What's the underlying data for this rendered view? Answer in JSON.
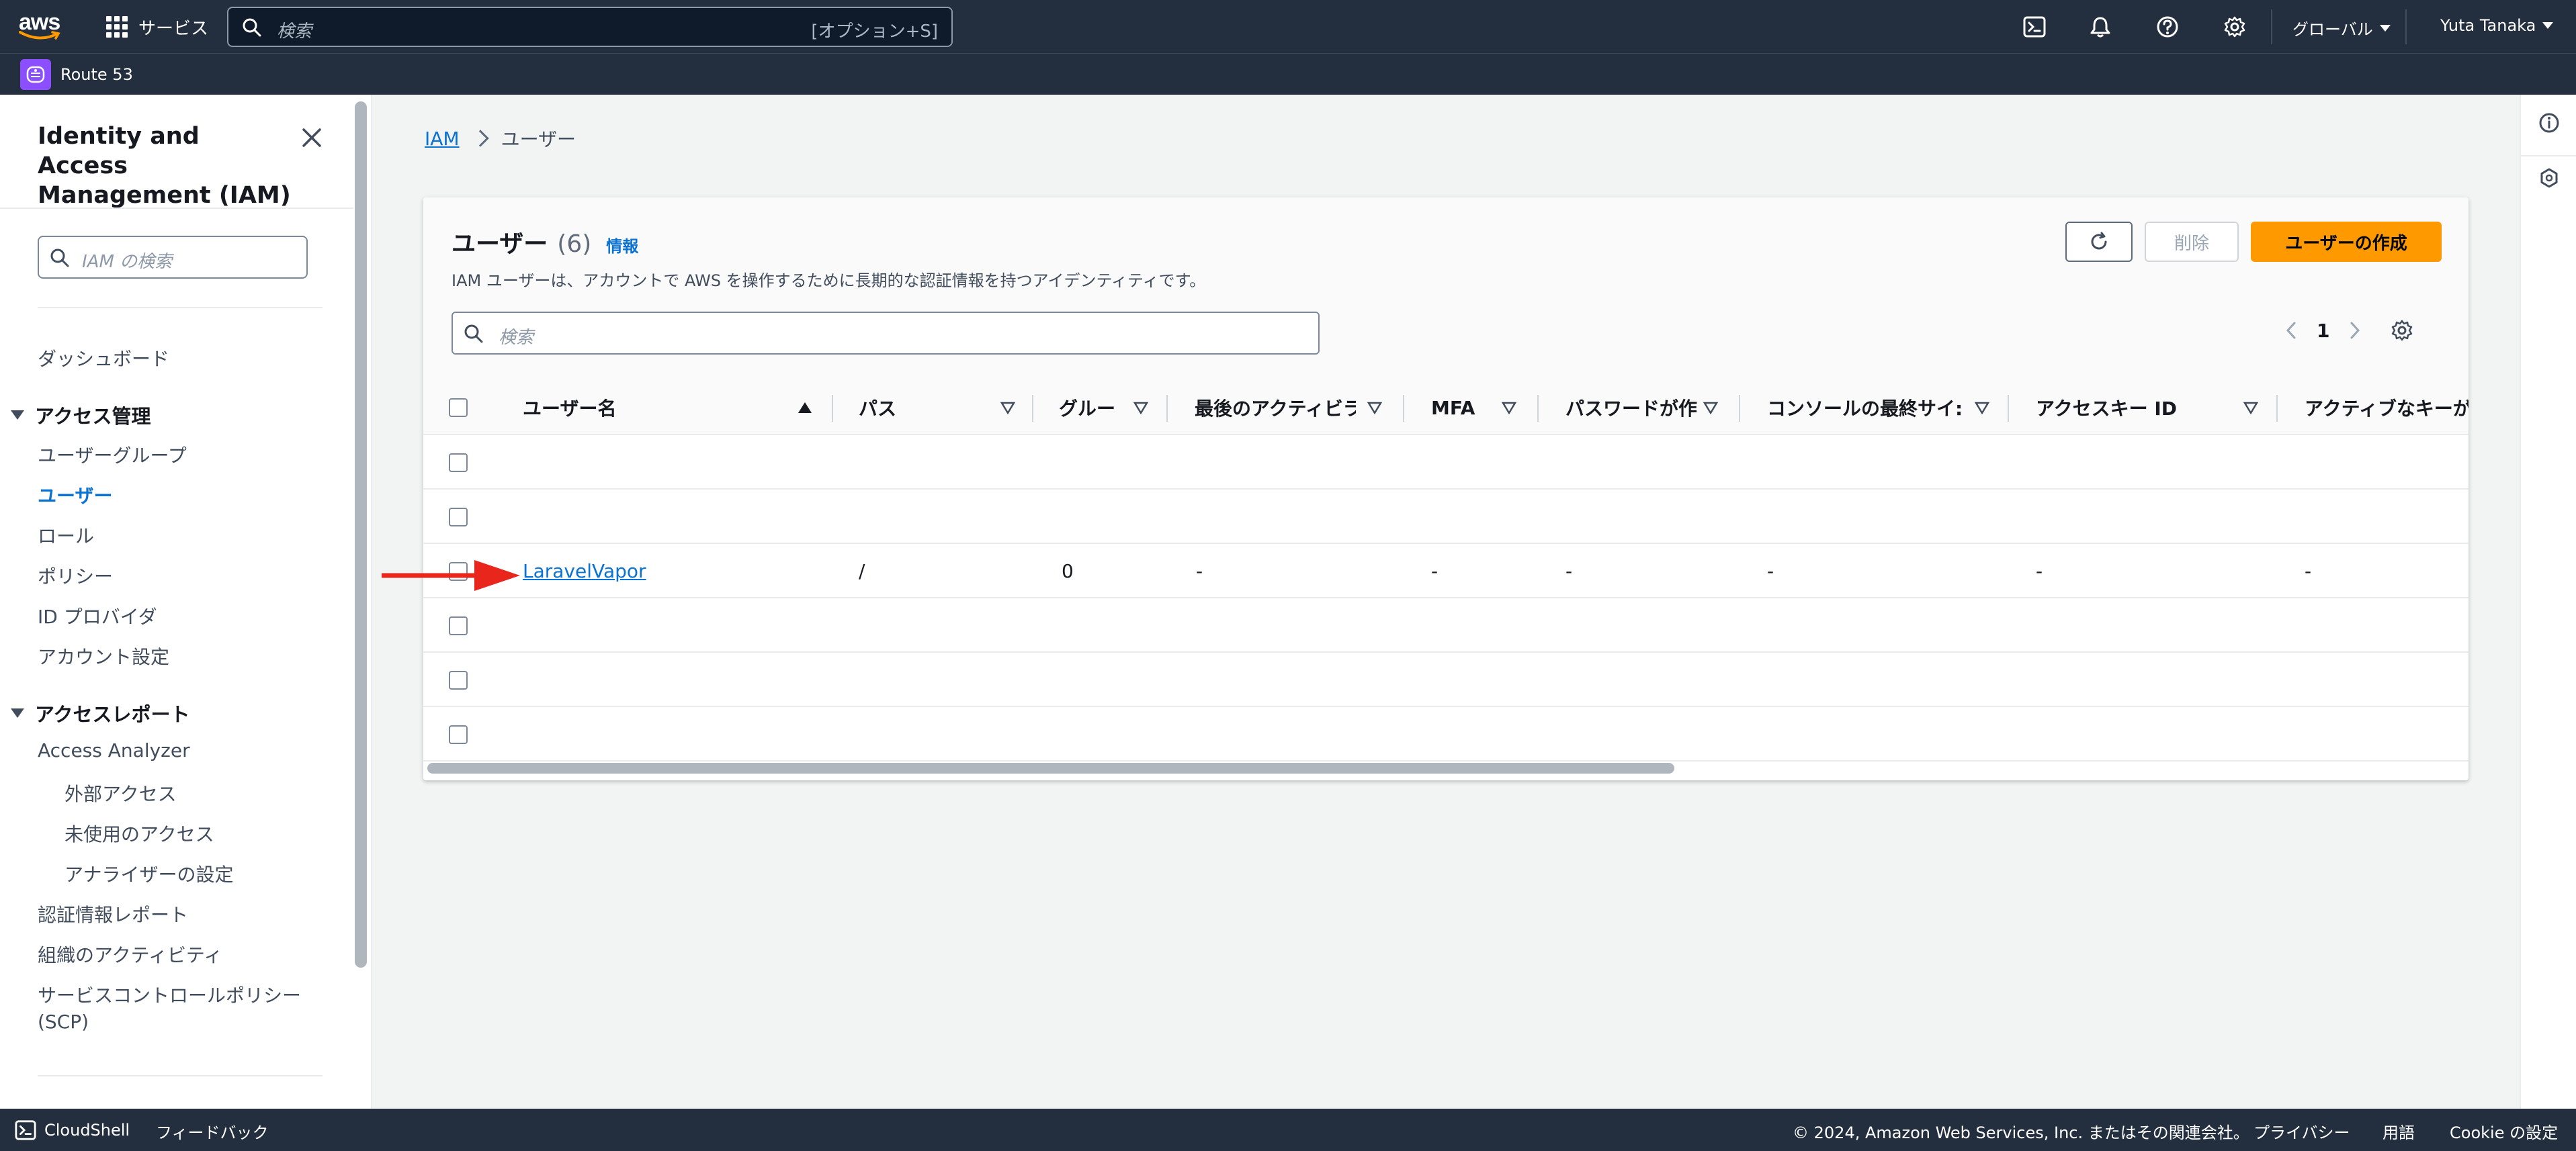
{
  "topnav": {
    "logo": "aws",
    "services_label": "サービス",
    "search_placeholder": "検索",
    "search_shortcut": "[オプション+S]",
    "region_label": "グローバル",
    "user_label": "Yuta Tanaka",
    "icons": [
      "cloudshell-icon",
      "bell-icon",
      "help-icon",
      "settings-icon"
    ]
  },
  "favorites": {
    "items": [
      {
        "label": "Route 53",
        "icon": "route53-icon"
      }
    ]
  },
  "sidebar": {
    "title": "Identity and Access Management (IAM)",
    "search_placeholder": "IAM の検索",
    "dashboard": "ダッシュボード",
    "section_access_mgmt": "アクセス管理",
    "access_items": [
      "ユーザーグループ",
      "ユーザー",
      "ロール",
      "ポリシー",
      "ID プロバイダ",
      "アカウント設定"
    ],
    "section_access_reports": "アクセスレポート",
    "report_items": [
      "Access Analyzer",
      "外部アクセス",
      "未使用のアクセス",
      "アナライザーの設定",
      "認証情報レポート",
      "組織のアクティビティ",
      "サービスコントロールポリシー",
      "(SCP)"
    ]
  },
  "breadcrumb": {
    "root": "IAM",
    "current": "ユーザー"
  },
  "users_panel": {
    "title": "ユーザー",
    "count": "(6)",
    "info_link": "情報",
    "description": "IAM ユーザーは、アカウントで AWS を操作するために長期的な認証情報を持つアイデンティティです。",
    "refresh_icon": "refresh-icon",
    "delete_label": "削除",
    "create_label": "ユーザーの作成",
    "search_placeholder": "検索",
    "page": "1",
    "columns": [
      "ユーザー名",
      "パス",
      "グルー:",
      "最後のアクティビラ",
      "MFA",
      "パスワードが作",
      "コンソールの最終サイ:",
      "アクセスキー ID",
      "アクティブなキーが"
    ],
    "rows": [
      [
        "",
        "",
        "",
        "",
        "",
        "",
        "",
        "",
        ""
      ],
      [
        "",
        "",
        "",
        "",
        "",
        "",
        "",
        "",
        ""
      ],
      [
        "LaravelVapor",
        "/",
        "0",
        "-",
        "-",
        "-",
        "-",
        "-",
        "-"
      ],
      [
        "",
        "",
        "",
        "",
        "",
        "",
        "",
        "",
        ""
      ],
      [
        "",
        "",
        "",
        "",
        "",
        "",
        "",
        "",
        ""
      ],
      [
        "",
        "",
        "",
        "",
        "",
        "",
        "",
        "",
        ""
      ]
    ]
  },
  "annotation": {
    "color": "#e8261c"
  },
  "footer": {
    "cloudshell": "CloudShell",
    "feedback": "フィードバック",
    "copyright": "© 2024, Amazon Web Services, Inc. またはその関連会社。",
    "privacy": "プライバシー",
    "terms": "用語",
    "cookie": "Cookie の設定"
  },
  "colors": {
    "nav_bg": "#232f3e",
    "link": "#0972d3",
    "primary_button": "#ff9900"
  }
}
